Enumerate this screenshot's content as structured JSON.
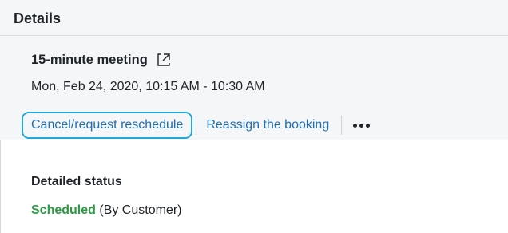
{
  "section": {
    "title": "Details"
  },
  "booking": {
    "title": "15-minute meeting",
    "external_icon": "external-link-icon",
    "time": "Mon, Feb 24, 2020, 10:15 AM - 10:30 AM"
  },
  "actions": {
    "cancel_label": "Cancel/request reschedule",
    "reassign_label": "Reassign the booking",
    "more_icon": "more-horizontal-icon"
  },
  "status": {
    "label": "Detailed status",
    "value": "Scheduled",
    "source": "(By Customer)"
  },
  "colors": {
    "link": "#1f6fb3",
    "focus_ring": "#25a7d8",
    "status_scheduled": "#2e9a44",
    "panel_bg": "#f5f6f7"
  }
}
